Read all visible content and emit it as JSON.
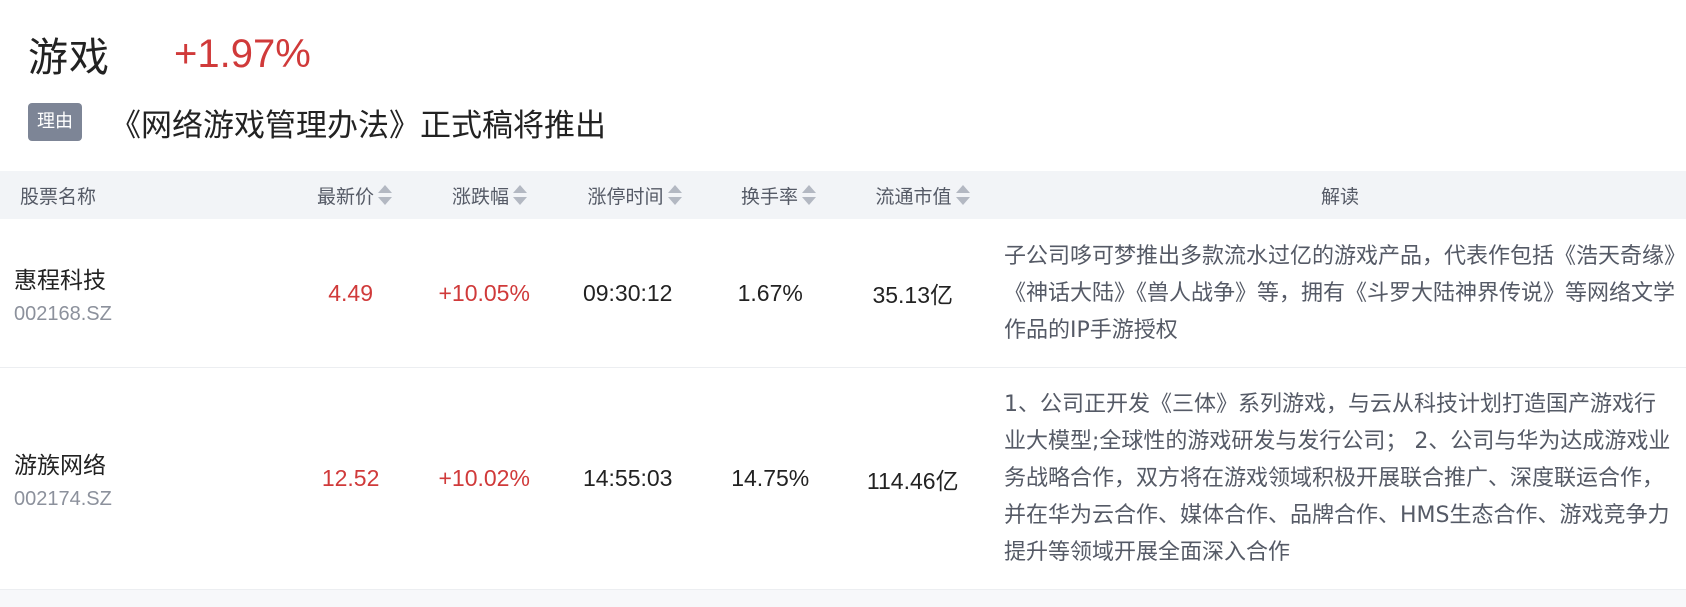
{
  "header": {
    "sector_name": "游戏",
    "sector_change": "+1.97%"
  },
  "reason": {
    "tag": "理由",
    "text": "《网络游戏管理办法》正式稿将推出"
  },
  "table": {
    "columns": [
      {
        "label": "股票名称",
        "sortable": false
      },
      {
        "label": "最新价",
        "sortable": true
      },
      {
        "label": "涨跌幅",
        "sortable": true
      },
      {
        "label": "涨停时间",
        "sortable": true
      },
      {
        "label": "换手率",
        "sortable": true
      },
      {
        "label": "流通市值",
        "sortable": true
      },
      {
        "label": "解读",
        "sortable": false
      }
    ],
    "rows": [
      {
        "name": "惠程科技",
        "code": "002168.SZ",
        "price": "4.49",
        "change": "+10.05%",
        "limit_time": "09:30:12",
        "turnover": "1.67%",
        "float_cap": "35.13亿",
        "desc": "子公司哆可梦推出多款流水过亿的游戏产品，代表作包括《浩天奇缘》《神话大陆》《兽人战争》等，拥有《斗罗大陆神界传说》等网络文学作品的IP手游授权"
      },
      {
        "name": "游族网络",
        "code": "002174.SZ",
        "price": "12.52",
        "change": "+10.02%",
        "limit_time": "14:55:03",
        "turnover": "14.75%",
        "float_cap": "114.46亿",
        "desc": "1、公司正开发《三体》系列游戏，与云从科技计划打造国产游戏行业大模型;全球性的游戏研发与发行公司； 2、公司与华为达成游戏业务战略合作，双方将在游戏领域积极开展联合推广、深度联运合作，并在华为云合作、媒体合作、品牌合作、HMS生态合作、游戏竞争力提升等领域开展全面深入合作"
      }
    ]
  },
  "colors": {
    "up": "#d03a3a",
    "tag_bg": "#7d8596",
    "header_bg": "#f2f4f7"
  },
  "icons": {
    "sort": "sort-updown-icon"
  }
}
